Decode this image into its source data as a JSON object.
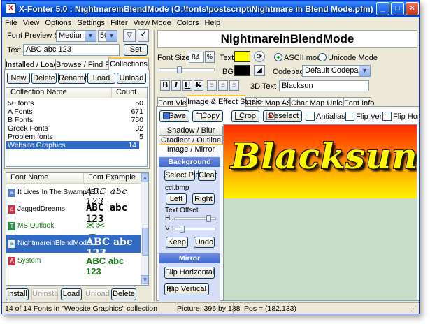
{
  "window": {
    "title": "X-Fonter 5.0 : NightmareinBlendMode (G:\\fonts\\postscript\\Nightmare in Blend Mode.pfm)"
  },
  "title_buttons": {
    "minimize": "_",
    "maximize": "□",
    "close": "✕"
  },
  "menu": [
    "File",
    "View",
    "Options",
    "Settings",
    "Filter",
    "View Mode",
    "Colors",
    "Help"
  ],
  "left": {
    "preview_size_label": "Font Preview Size",
    "preview_size_value": "Medium",
    "preview_size_number": "50",
    "text_label": "Text",
    "text_value": "ABC abc 123",
    "set_button": "Set",
    "tabs": [
      "Installed / Loaded",
      "Browse / Find Fonts",
      "Collections"
    ],
    "coll_buttons": [
      "New",
      "Delete",
      "Rename",
      "Load",
      "Unload"
    ],
    "coll_headers": {
      "name": "Collection Name",
      "count": "Count"
    },
    "collections": [
      {
        "name": "50 fonts",
        "count": "50"
      },
      {
        "name": "A Fonts",
        "count": "671"
      },
      {
        "name": "B Fonts",
        "count": "750"
      },
      {
        "name": "Greek Fonts",
        "count": "32"
      },
      {
        "name": "Problem fonts",
        "count": "5"
      },
      {
        "name": "Website Graphics",
        "count": "14"
      }
    ],
    "font_headers": {
      "name": "Font Name",
      "example": "Font Example"
    },
    "fonts": [
      {
        "name": "It Lives In The Swamp (B...",
        "example": "ABC abc 123",
        "color": "#000000"
      },
      {
        "name": "JaggedDreams",
        "example": "ABC abc 123",
        "color": "#000000"
      },
      {
        "name": "MS Outlook",
        "example": "✉✂☎⟳✓",
        "color": "#1a7a1a"
      },
      {
        "name": "NightmareinBlendMode",
        "example": "ABC abc 123",
        "color": "#ffffff"
      },
      {
        "name": "System",
        "example": "ABC abc 123",
        "color": "#1a7a1a"
      }
    ],
    "bottom_buttons": [
      "Install",
      "Uninstall",
      "Load",
      "Unload",
      "Delete"
    ]
  },
  "right": {
    "font_title": "NightmareinBlendMode",
    "font_size_label": "Font Size",
    "font_size_value": "84",
    "text_color_label": "Text:",
    "bg_label": "BG:",
    "text_color": "#ffff00",
    "bg_color": "#000000",
    "ascii_mode": "ASCII mode",
    "unicode_mode": "Unicode Mode",
    "codepage_label": "Codepage",
    "codepage_value": "Default Codepage",
    "format_buttons": [
      "B",
      "I",
      "U",
      "K"
    ],
    "text3d_label": "3D Text",
    "text3d_value": "Blacksun",
    "tabs": [
      "Font View",
      "Image & Effect Studio",
      "Char Map ASCII",
      "Char Map Unicode",
      "Font Info"
    ],
    "studio_buttons": [
      "Save",
      "Copy",
      "Crop",
      "Deselect"
    ],
    "studio_checks": [
      "Antialiased",
      "Flip Vert",
      "Flip Hor"
    ],
    "side_tabs": [
      "Shadow / Blur",
      "Gradient / Outline",
      "Image / Mirror"
    ],
    "bg_image_head": "Background Image",
    "select_pic": "Select Pic",
    "clear": "Clear",
    "image_file": "cci.bmp",
    "left_btn": "Left",
    "right_btn": "Right",
    "text_offset": "Text Offset",
    "h_label": "H :",
    "v_label": "V :",
    "keep": "Keep",
    "undo": "Undo",
    "mirror_head": "Mirror",
    "flip_horizontal": "Flip Horizontal",
    "flip_vertical": "Flip Vertical",
    "canvas_text": "Blacksun",
    "colors": {
      "gradient_top": "#ff2a00",
      "gradient_mid": "#ff9a00",
      "gradient_bottom": "#fff000",
      "canvas_bg": "#c8dcc8"
    }
  },
  "status": {
    "left": "14 of 14 Fonts in \"Website Graphics\" collection",
    "picture": "Picture: 396 by 138",
    "pos": "Pos = (182,133)"
  }
}
